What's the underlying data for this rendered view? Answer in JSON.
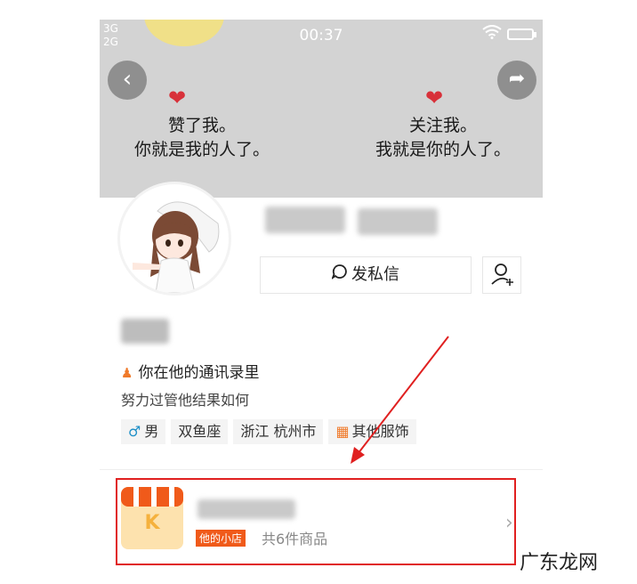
{
  "status_bar": {
    "signal_1": "3G",
    "signal_2": "2G",
    "time": "00:37"
  },
  "cover": {
    "quote_left": "赞了我。\n你就是我的人了。",
    "quote_right": "关注我。\n我就是你的人了。"
  },
  "actions": {
    "message_label": "发私信"
  },
  "profile": {
    "contacts_note": "你在他的通讯录里",
    "motto": "努力过管他结果如何"
  },
  "tags": {
    "gender": "男",
    "zodiac": "双鱼座",
    "location": "浙江 杭州市",
    "category": "其他服饰"
  },
  "shop": {
    "logo_letter": "K",
    "badge": "他的小店",
    "count": "共6件商品"
  },
  "watermark": "广东龙网",
  "colors": {
    "accent": "#f05a1a",
    "highlight": "#e02020",
    "heart": "#d8313a"
  }
}
